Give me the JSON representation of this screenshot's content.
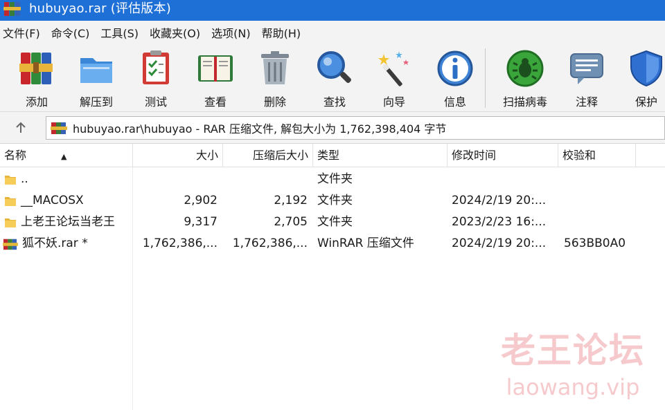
{
  "window": {
    "title": "hubuyao.rar (评估版本)",
    "title_bar_color": "#1e6fd6"
  },
  "menu": [
    {
      "label": "文件(F)"
    },
    {
      "label": "命令(C)"
    },
    {
      "label": "工具(S)"
    },
    {
      "label": "收藏夹(O)"
    },
    {
      "label": "选项(N)"
    },
    {
      "label": "帮助(H)"
    }
  ],
  "toolbar": [
    {
      "label": "添加",
      "icon": "books-icon"
    },
    {
      "label": "解压到",
      "icon": "folder-icon"
    },
    {
      "label": "测试",
      "icon": "clipboard-check-icon"
    },
    {
      "label": "查看",
      "icon": "open-book-icon"
    },
    {
      "label": "删除",
      "icon": "trash-icon"
    },
    {
      "label": "查找",
      "icon": "magnifier-icon"
    },
    {
      "label": "向导",
      "icon": "magic-wand-icon"
    },
    {
      "label": "信息",
      "icon": "info-icon"
    },
    {
      "label": "扫描病毒",
      "icon": "virus-scan-icon"
    },
    {
      "label": "注释",
      "icon": "comment-icon"
    },
    {
      "label": "保护",
      "icon": "shield-icon"
    }
  ],
  "address": {
    "path": "hubuyao.rar\\hubuyao - RAR 压缩文件, 解包大小为 1,762,398,404 字节"
  },
  "columns": [
    {
      "label": "名称"
    },
    {
      "label": "大小"
    },
    {
      "label": "压缩后大小"
    },
    {
      "label": "类型"
    },
    {
      "label": "修改时间"
    },
    {
      "label": "校验和"
    }
  ],
  "files": [
    {
      "name": "..",
      "size": "",
      "packed": "",
      "type": "文件夹",
      "modified": "",
      "crc": "",
      "icon": "folder-icon"
    },
    {
      "name": "__MACOSX",
      "size": "2,902",
      "packed": "2,192",
      "type": "文件夹",
      "modified": "2024/2/19 20:...",
      "crc": "",
      "icon": "folder-icon"
    },
    {
      "name": "上老王论坛当老王",
      "size": "9,317",
      "packed": "2,705",
      "type": "文件夹",
      "modified": "2023/2/23 16:...",
      "crc": "",
      "icon": "folder-icon"
    },
    {
      "name": "狐不妖.rar *",
      "size": "1,762,386,...",
      "packed": "1,762,386,...",
      "type": "WinRAR 压缩文件",
      "modified": "2024/2/19 20:...",
      "crc": "563BB0A0",
      "icon": "rar-archive-icon"
    }
  ],
  "watermark": {
    "title": "老王论坛",
    "url": "laowang.vip",
    "color": "#e25a64"
  }
}
